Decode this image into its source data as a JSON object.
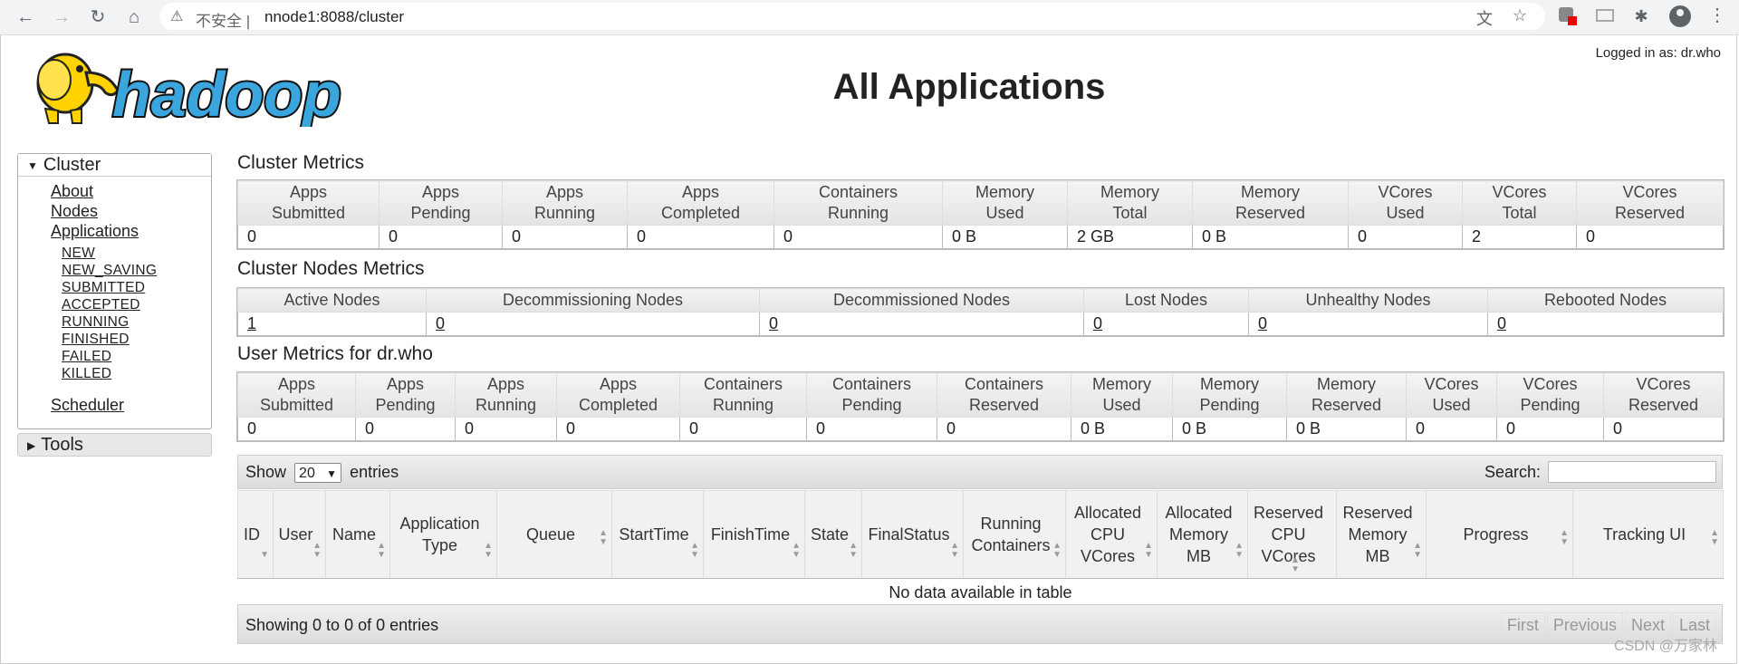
{
  "browser": {
    "security_text": "不安全",
    "url": "nnode1:8088/cluster"
  },
  "header": {
    "logged_in": "Logged in as: dr.who",
    "title": "All Applications",
    "logo_text": "hadoop"
  },
  "sidebar": {
    "cluster_label": "Cluster",
    "links": [
      "About",
      "Nodes",
      "Applications"
    ],
    "app_states": [
      "NEW",
      "NEW_SAVING",
      "SUBMITTED",
      "ACCEPTED",
      "RUNNING",
      "FINISHED",
      "FAILED",
      "KILLED"
    ],
    "scheduler": "Scheduler",
    "tools_label": "Tools"
  },
  "cluster_metrics": {
    "title": "Cluster Metrics",
    "headers": [
      [
        "Apps",
        "Submitted"
      ],
      [
        "Apps",
        "Pending"
      ],
      [
        "Apps",
        "Running"
      ],
      [
        "Apps",
        "Completed"
      ],
      [
        "Containers",
        "Running"
      ],
      [
        "Memory",
        "Used"
      ],
      [
        "Memory",
        "Total"
      ],
      [
        "Memory",
        "Reserved"
      ],
      [
        "VCores",
        "Used"
      ],
      [
        "VCores",
        "Total"
      ],
      [
        "VCores",
        "Reserved"
      ]
    ],
    "values": [
      "0",
      "0",
      "0",
      "0",
      "0",
      "0 B",
      "2 GB",
      "0 B",
      "0",
      "2",
      "0"
    ]
  },
  "node_metrics": {
    "title": "Cluster Nodes Metrics",
    "headers": [
      "Active Nodes",
      "Decommissioning Nodes",
      "Decommissioned Nodes",
      "Lost Nodes",
      "Unhealthy Nodes",
      "Rebooted Nodes"
    ],
    "values": [
      "1",
      "0",
      "0",
      "0",
      "0",
      "0"
    ]
  },
  "user_metrics": {
    "title": "User Metrics for dr.who",
    "headers": [
      [
        "Apps",
        "Submitted"
      ],
      [
        "Apps",
        "Pending"
      ],
      [
        "Apps",
        "Running"
      ],
      [
        "Apps",
        "Completed"
      ],
      [
        "Containers",
        "Running"
      ],
      [
        "Containers",
        "Pending"
      ],
      [
        "Containers",
        "Reserved"
      ],
      [
        "Memory",
        "Used"
      ],
      [
        "Memory",
        "Pending"
      ],
      [
        "Memory",
        "Reserved"
      ],
      [
        "VCores",
        "Used"
      ],
      [
        "VCores",
        "Pending"
      ],
      [
        "VCores",
        "Reserved"
      ]
    ],
    "values": [
      "0",
      "0",
      "0",
      "0",
      "0",
      "0",
      "0",
      "0 B",
      "0 B",
      "0 B",
      "0",
      "0",
      "0"
    ]
  },
  "apps_table": {
    "show_label": "Show",
    "entries_label": "entries",
    "page_size": "20",
    "search_label": "Search:",
    "columns": [
      [
        "ID"
      ],
      [
        "User"
      ],
      [
        "Name"
      ],
      [
        "Application",
        "Type"
      ],
      [
        "Queue"
      ],
      [
        "StartTime"
      ],
      [
        "FinishTime"
      ],
      [
        "State"
      ],
      [
        "FinalStatus"
      ],
      [
        "Running",
        "Containers"
      ],
      [
        "Allocated",
        "CPU",
        "VCores"
      ],
      [
        "Allocated",
        "Memory",
        "MB"
      ],
      [
        "Reserved",
        "CPU",
        "VCores"
      ],
      [
        "Reserved",
        "Memory",
        "MB"
      ],
      [
        "Progress"
      ],
      [
        "Tracking UI"
      ]
    ],
    "empty_text": "No data available in table",
    "info": "Showing 0 to 0 of 0 entries",
    "pager": [
      "First",
      "Previous",
      "Next",
      "Last"
    ]
  },
  "watermark": "CSDN @万家林",
  "colors": {
    "logo_yellow": "#ffd200",
    "logo_blue": "#3aa6dd"
  }
}
